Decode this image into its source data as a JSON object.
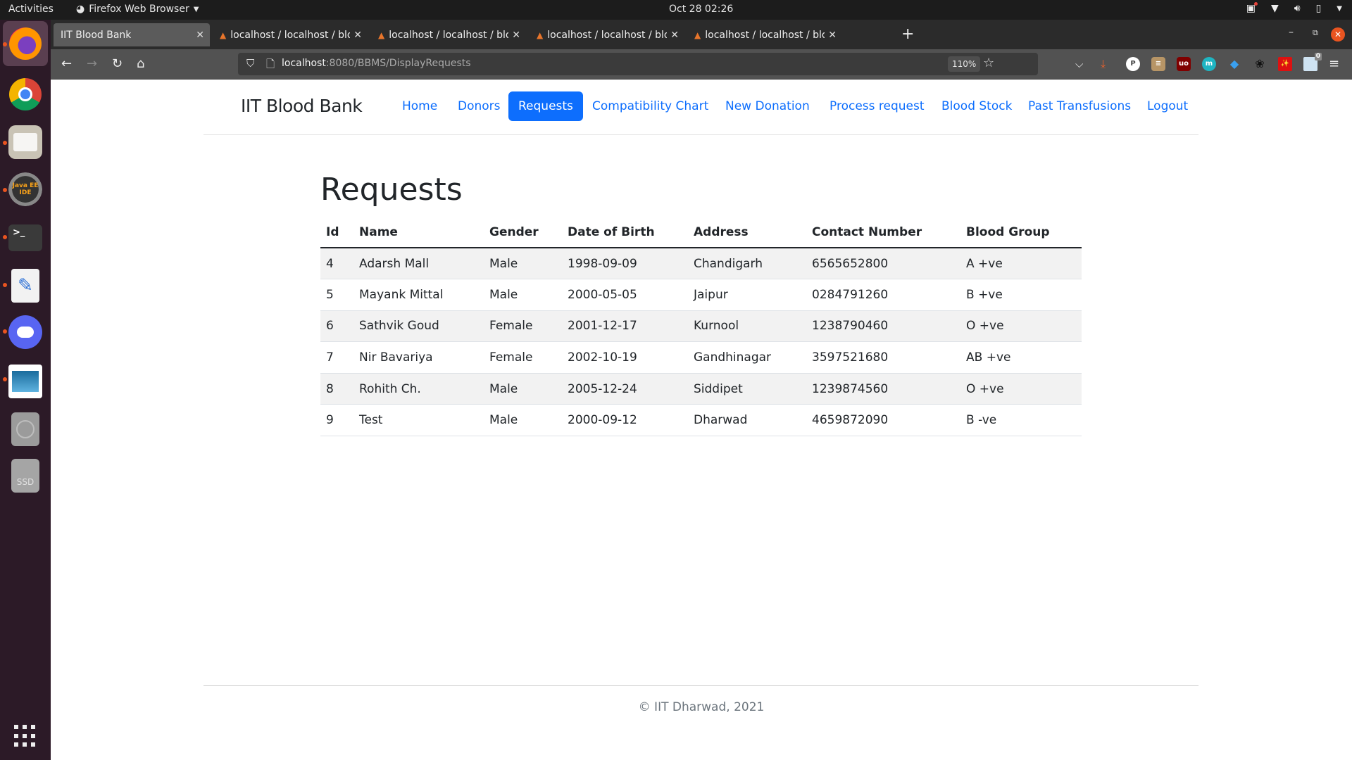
{
  "system": {
    "activities": "Activities",
    "app_name": "Firefox Web Browser",
    "clock": "Oct 28  02:26"
  },
  "dock": {
    "items": [
      {
        "name": "Firefox",
        "icon": "firefox-icon",
        "running": true,
        "active": true
      },
      {
        "name": "Google Chrome",
        "icon": "chrome-icon",
        "running": false
      },
      {
        "name": "Files",
        "icon": "folder-icon",
        "running": true
      },
      {
        "name": "Java EE IDE",
        "icon": "java-ee-ide-icon",
        "label": "Java EE IDE",
        "running": true
      },
      {
        "name": "Terminal",
        "icon": "terminal-icon",
        "label": ">_",
        "running": true
      },
      {
        "name": "Text Editor",
        "icon": "text-editor-icon",
        "running": true
      },
      {
        "name": "Discord",
        "icon": "discord-icon",
        "running": true
      },
      {
        "name": "Image Viewer",
        "icon": "image-viewer-icon",
        "running": true
      },
      {
        "name": "Optical Drive",
        "icon": "disc-icon",
        "running": false
      },
      {
        "name": "SSD",
        "icon": "ssd-icon",
        "label": "SSD",
        "running": false
      }
    ],
    "show_apps": "show-apps-icon"
  },
  "browser": {
    "tabs": [
      {
        "title": "IIT Blood Bank",
        "active": true
      },
      {
        "title": "localhost / localhost / blo",
        "active": false
      },
      {
        "title": "localhost / localhost / blo",
        "active": false
      },
      {
        "title": "localhost / localhost / blo",
        "active": false
      },
      {
        "title": "localhost / localhost / blo",
        "active": false
      }
    ],
    "url_host": "localhost",
    "url_rest": ":8080/BBMS/DisplayRequests",
    "zoom": "110%",
    "extensions_badge": "0"
  },
  "site": {
    "brand": "IIT Blood Bank",
    "nav": [
      {
        "label": "Home",
        "active": false
      },
      {
        "label": "Donors",
        "active": false
      },
      {
        "label": "Requests",
        "active": true
      },
      {
        "label": "Compatibility Chart",
        "active": false
      },
      {
        "label": "New Donation",
        "active": false
      },
      {
        "label": "Process request",
        "active": false
      },
      {
        "label": "Blood Stock",
        "active": false
      },
      {
        "label": "Past Transfusions",
        "active": false
      },
      {
        "label": "Logout",
        "active": false
      }
    ],
    "accent": "#0d6efd"
  },
  "main": {
    "title": "Requests",
    "table": {
      "headers": [
        "Id",
        "Name",
        "Gender",
        "Date of Birth",
        "Address",
        "Contact Number",
        "Blood Group"
      ],
      "rows": [
        [
          "4",
          "Adarsh Mall",
          "Male",
          "1998-09-09",
          "Chandigarh",
          "6565652800",
          "A +ve"
        ],
        [
          "5",
          "Mayank Mittal",
          "Male",
          "2000-05-05",
          "Jaipur",
          "0284791260",
          "B +ve"
        ],
        [
          "6",
          "Sathvik Goud",
          "Female",
          "2001-12-17",
          "Kurnool",
          "1238790460",
          "O +ve"
        ],
        [
          "7",
          "Nir Bavariya",
          "Female",
          "2002-10-19",
          "Gandhinagar",
          "3597521680",
          "AB +ve"
        ],
        [
          "8",
          "Rohith Ch.",
          "Male",
          "2005-12-24",
          "Siddipet",
          "1239874560",
          "O +ve"
        ],
        [
          "9",
          "Test",
          "Male",
          "2000-09-12",
          "Dharwad",
          "4659872090",
          "B -ve"
        ]
      ]
    }
  },
  "footer": {
    "text": "© IIT Dharwad, 2021"
  }
}
